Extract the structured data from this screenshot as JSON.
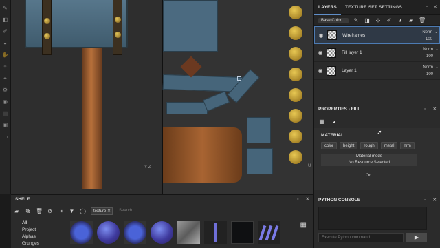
{
  "left_toolbar": {
    "icons": [
      "brush-icon",
      "eraser-icon",
      "projection-icon",
      "geometry-mask-icon",
      "smudge-icon",
      "clone-icon",
      "color-picker-icon",
      "settings-icon",
      "sphere-icon",
      "layers-icon",
      "photoshop-icon",
      "document-icon"
    ]
  },
  "viewport": {
    "axis_3d": {
      "y": "Y",
      "z": "Z"
    },
    "axis_2d": {
      "u": "U"
    }
  },
  "layers_panel": {
    "tabs": [
      "LAYERS",
      "TEXTURE SET SETTINGS"
    ],
    "channel_select": "Base Color",
    "layers": [
      {
        "name": "Wireframes",
        "blend": "Norm",
        "opacity": "100",
        "selected": true
      },
      {
        "name": "Fill layer 1",
        "blend": "Norm",
        "opacity": "100",
        "selected": false
      },
      {
        "name": "Layer 1",
        "blend": "Norm",
        "opacity": "100",
        "selected": false
      }
    ]
  },
  "properties": {
    "title": "PROPERTIES - FILL",
    "section": "MATERIAL",
    "chips": [
      "color",
      "height",
      "rough",
      "metal",
      "nrm"
    ],
    "material_mode_label": "Material mode",
    "material_mode_value": "No Resource Selected",
    "or_label": "Or"
  },
  "python_console": {
    "title": "PYTHON CONSOLE",
    "placeholder": "Execute Python command..."
  },
  "shelf": {
    "title": "SHELF",
    "filter_chip": "texture",
    "search_placeholder": "Search...",
    "categories": [
      "All",
      "Project",
      "Alphas",
      "Grunges"
    ]
  },
  "colors": {
    "accent": "#4d7bb3",
    "panel_bg": "#2b2b2b",
    "toolbar_bg": "#262626"
  }
}
